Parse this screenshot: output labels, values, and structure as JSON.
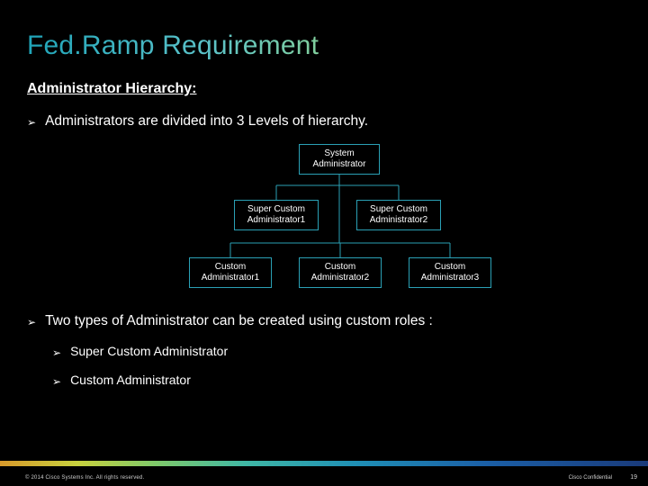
{
  "title": "Fed.Ramp Requirement",
  "subheading": "Administrator Hierarchy:",
  "bullets": {
    "b1": "Administrators are divided into 3 Levels of hierarchy.",
    "b2": "Two types of Administrator can be created using custom roles :",
    "b2a": "Super Custom Administrator",
    "b2b": "Custom Administrator"
  },
  "org": {
    "top": "System\nAdministrator",
    "s1": "Super Custom\nAdministrator1",
    "s2": "Super Custom\nAdministrator2",
    "c1": "Custom\nAdministrator1",
    "c2": "Custom\nAdministrator2",
    "c3": "Custom\nAdministrator3"
  },
  "footer": {
    "copyright": "© 2014 Cisco Systems Inc. All rights reserved.",
    "confidential": "Cisco Confidential",
    "page": "19"
  }
}
